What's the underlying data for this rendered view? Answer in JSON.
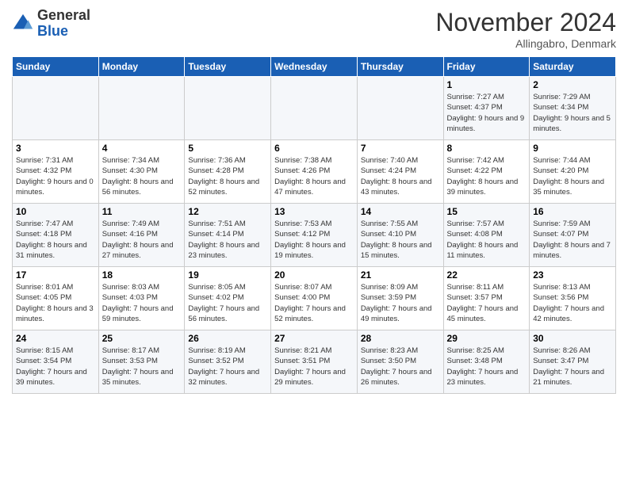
{
  "header": {
    "logo_general": "General",
    "logo_blue": "Blue",
    "month_title": "November 2024",
    "location": "Allingabro, Denmark"
  },
  "days_of_week": [
    "Sunday",
    "Monday",
    "Tuesday",
    "Wednesday",
    "Thursday",
    "Friday",
    "Saturday"
  ],
  "weeks": [
    [
      {
        "day": "",
        "info": ""
      },
      {
        "day": "",
        "info": ""
      },
      {
        "day": "",
        "info": ""
      },
      {
        "day": "",
        "info": ""
      },
      {
        "day": "",
        "info": ""
      },
      {
        "day": "1",
        "info": "Sunrise: 7:27 AM\nSunset: 4:37 PM\nDaylight: 9 hours and 9 minutes."
      },
      {
        "day": "2",
        "info": "Sunrise: 7:29 AM\nSunset: 4:34 PM\nDaylight: 9 hours and 5 minutes."
      }
    ],
    [
      {
        "day": "3",
        "info": "Sunrise: 7:31 AM\nSunset: 4:32 PM\nDaylight: 9 hours and 0 minutes."
      },
      {
        "day": "4",
        "info": "Sunrise: 7:34 AM\nSunset: 4:30 PM\nDaylight: 8 hours and 56 minutes."
      },
      {
        "day": "5",
        "info": "Sunrise: 7:36 AM\nSunset: 4:28 PM\nDaylight: 8 hours and 52 minutes."
      },
      {
        "day": "6",
        "info": "Sunrise: 7:38 AM\nSunset: 4:26 PM\nDaylight: 8 hours and 47 minutes."
      },
      {
        "day": "7",
        "info": "Sunrise: 7:40 AM\nSunset: 4:24 PM\nDaylight: 8 hours and 43 minutes."
      },
      {
        "day": "8",
        "info": "Sunrise: 7:42 AM\nSunset: 4:22 PM\nDaylight: 8 hours and 39 minutes."
      },
      {
        "day": "9",
        "info": "Sunrise: 7:44 AM\nSunset: 4:20 PM\nDaylight: 8 hours and 35 minutes."
      }
    ],
    [
      {
        "day": "10",
        "info": "Sunrise: 7:47 AM\nSunset: 4:18 PM\nDaylight: 8 hours and 31 minutes."
      },
      {
        "day": "11",
        "info": "Sunrise: 7:49 AM\nSunset: 4:16 PM\nDaylight: 8 hours and 27 minutes."
      },
      {
        "day": "12",
        "info": "Sunrise: 7:51 AM\nSunset: 4:14 PM\nDaylight: 8 hours and 23 minutes."
      },
      {
        "day": "13",
        "info": "Sunrise: 7:53 AM\nSunset: 4:12 PM\nDaylight: 8 hours and 19 minutes."
      },
      {
        "day": "14",
        "info": "Sunrise: 7:55 AM\nSunset: 4:10 PM\nDaylight: 8 hours and 15 minutes."
      },
      {
        "day": "15",
        "info": "Sunrise: 7:57 AM\nSunset: 4:08 PM\nDaylight: 8 hours and 11 minutes."
      },
      {
        "day": "16",
        "info": "Sunrise: 7:59 AM\nSunset: 4:07 PM\nDaylight: 8 hours and 7 minutes."
      }
    ],
    [
      {
        "day": "17",
        "info": "Sunrise: 8:01 AM\nSunset: 4:05 PM\nDaylight: 8 hours and 3 minutes."
      },
      {
        "day": "18",
        "info": "Sunrise: 8:03 AM\nSunset: 4:03 PM\nDaylight: 7 hours and 59 minutes."
      },
      {
        "day": "19",
        "info": "Sunrise: 8:05 AM\nSunset: 4:02 PM\nDaylight: 7 hours and 56 minutes."
      },
      {
        "day": "20",
        "info": "Sunrise: 8:07 AM\nSunset: 4:00 PM\nDaylight: 7 hours and 52 minutes."
      },
      {
        "day": "21",
        "info": "Sunrise: 8:09 AM\nSunset: 3:59 PM\nDaylight: 7 hours and 49 minutes."
      },
      {
        "day": "22",
        "info": "Sunrise: 8:11 AM\nSunset: 3:57 PM\nDaylight: 7 hours and 45 minutes."
      },
      {
        "day": "23",
        "info": "Sunrise: 8:13 AM\nSunset: 3:56 PM\nDaylight: 7 hours and 42 minutes."
      }
    ],
    [
      {
        "day": "24",
        "info": "Sunrise: 8:15 AM\nSunset: 3:54 PM\nDaylight: 7 hours and 39 minutes."
      },
      {
        "day": "25",
        "info": "Sunrise: 8:17 AM\nSunset: 3:53 PM\nDaylight: 7 hours and 35 minutes."
      },
      {
        "day": "26",
        "info": "Sunrise: 8:19 AM\nSunset: 3:52 PM\nDaylight: 7 hours and 32 minutes."
      },
      {
        "day": "27",
        "info": "Sunrise: 8:21 AM\nSunset: 3:51 PM\nDaylight: 7 hours and 29 minutes."
      },
      {
        "day": "28",
        "info": "Sunrise: 8:23 AM\nSunset: 3:50 PM\nDaylight: 7 hours and 26 minutes."
      },
      {
        "day": "29",
        "info": "Sunrise: 8:25 AM\nSunset: 3:48 PM\nDaylight: 7 hours and 23 minutes."
      },
      {
        "day": "30",
        "info": "Sunrise: 8:26 AM\nSunset: 3:47 PM\nDaylight: 7 hours and 21 minutes."
      }
    ]
  ]
}
